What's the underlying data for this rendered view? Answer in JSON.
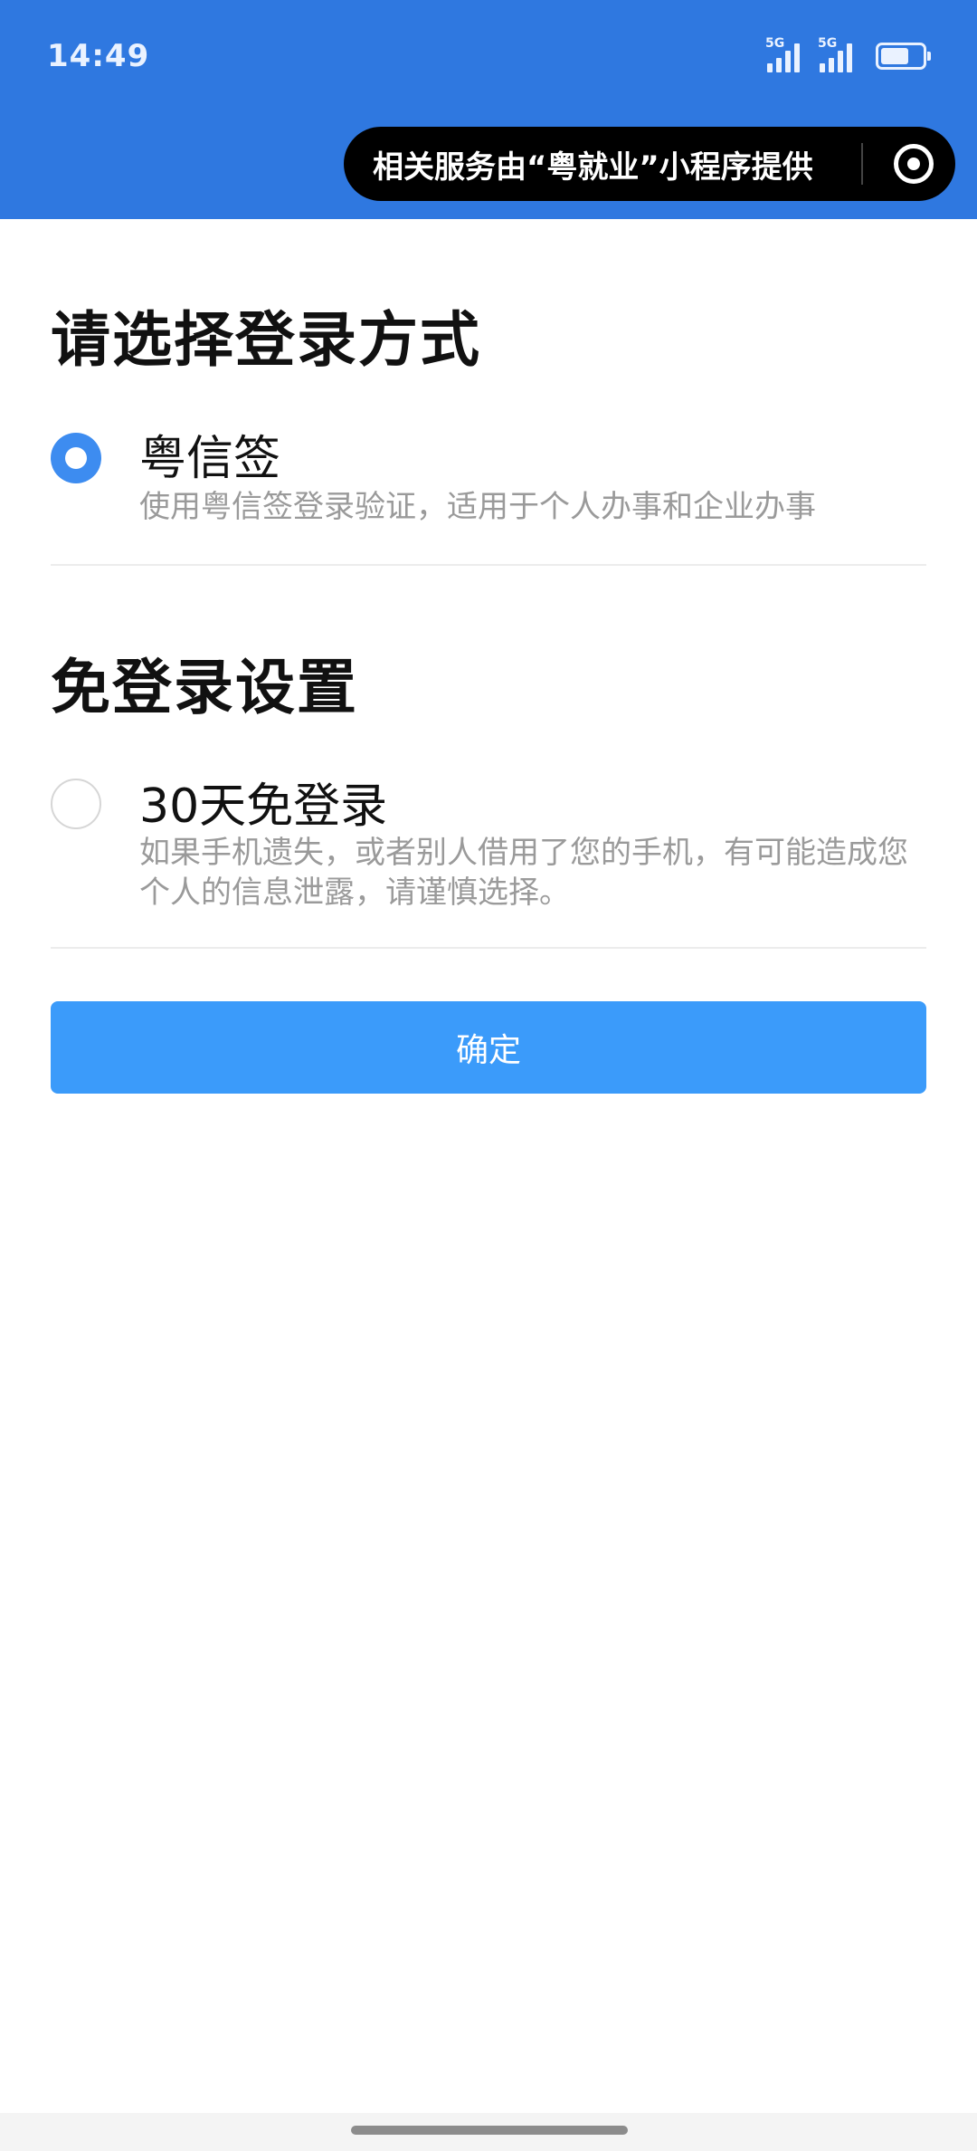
{
  "status_bar": {
    "time": "14:49",
    "signal1_label": "5G",
    "signal2_label": "5G",
    "icons": [
      "signal-5g-icon",
      "signal-5g-icon",
      "battery-icon"
    ]
  },
  "capsule": {
    "text": "相关服务由“粤就业”小程序提供",
    "icon": "target-icon"
  },
  "login_section": {
    "title": "请选择登录方式",
    "option": {
      "title": "粤信签",
      "description": "使用粤信签登录验证，适用于个人办事和企业办事",
      "selected": true
    }
  },
  "auto_login_section": {
    "title": "免登录设置",
    "option": {
      "title": "30天免登录",
      "description": "如果手机遗失，或者别人借用了您的手机，有可能造成您个人的信息泄露，请谨慎选择。",
      "selected": false
    }
  },
  "confirm_button": {
    "label": "确定"
  },
  "colors": {
    "header_blue": "#2f78e0",
    "radio_blue": "#3d8cf0",
    "button_blue": "#3b9bfa",
    "desc_gray": "#9a9a9a"
  }
}
